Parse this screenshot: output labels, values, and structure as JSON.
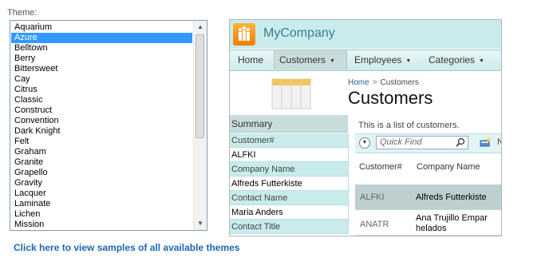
{
  "theme_label": "Theme:",
  "themes": [
    {
      "name": "Aquarium"
    },
    {
      "name": "Azure",
      "selected": true
    },
    {
      "name": "Belltown"
    },
    {
      "name": "Berry"
    },
    {
      "name": "Bittersweet"
    },
    {
      "name": "Cay"
    },
    {
      "name": "Citrus"
    },
    {
      "name": "Classic"
    },
    {
      "name": "Construct"
    },
    {
      "name": "Convention"
    },
    {
      "name": "Dark Knight"
    },
    {
      "name": "Felt"
    },
    {
      "name": "Graham"
    },
    {
      "name": "Granite"
    },
    {
      "name": "Grapello"
    },
    {
      "name": "Gravity"
    },
    {
      "name": "Lacquer"
    },
    {
      "name": "Laminate"
    },
    {
      "name": "Lichen"
    },
    {
      "name": "Mission"
    }
  ],
  "samples_link": "Click here to view samples of all available themes",
  "preview": {
    "company": "MyCompany",
    "menu": [
      {
        "label": "Home",
        "dropdown": false
      },
      {
        "label": "Customers",
        "dropdown": true,
        "active": true
      },
      {
        "label": "Employees",
        "dropdown": true
      },
      {
        "label": "Categories",
        "dropdown": true
      }
    ],
    "breadcrumb": {
      "home": "Home",
      "separator": ">",
      "current": "Customers"
    },
    "page_title": "Customers",
    "summary": {
      "heading": "Summary",
      "rows": [
        {
          "text": "Customer#",
          "kind": "key"
        },
        {
          "text": "ALFKI",
          "kind": "val"
        },
        {
          "text": "Company Name",
          "kind": "key"
        },
        {
          "text": "Alfreds Futterkiste",
          "kind": "val"
        },
        {
          "text": "Contact Name",
          "kind": "key"
        },
        {
          "text": "Maria Anders",
          "kind": "val"
        },
        {
          "text": "Contact Title",
          "kind": "key"
        }
      ]
    },
    "description": "This is a list of customers.",
    "quick_find_placeholder": "Quick Find",
    "toolbar_trailing": "N",
    "columns": {
      "id": "Customer#",
      "name": "Company Name"
    },
    "rows": [
      {
        "id": "ALFKI",
        "name_lines": [
          "Alfreds Futterkiste"
        ]
      },
      {
        "id": "ANATR",
        "name_lines": [
          "Ana Trujillo Empar",
          "helados"
        ]
      }
    ]
  }
}
